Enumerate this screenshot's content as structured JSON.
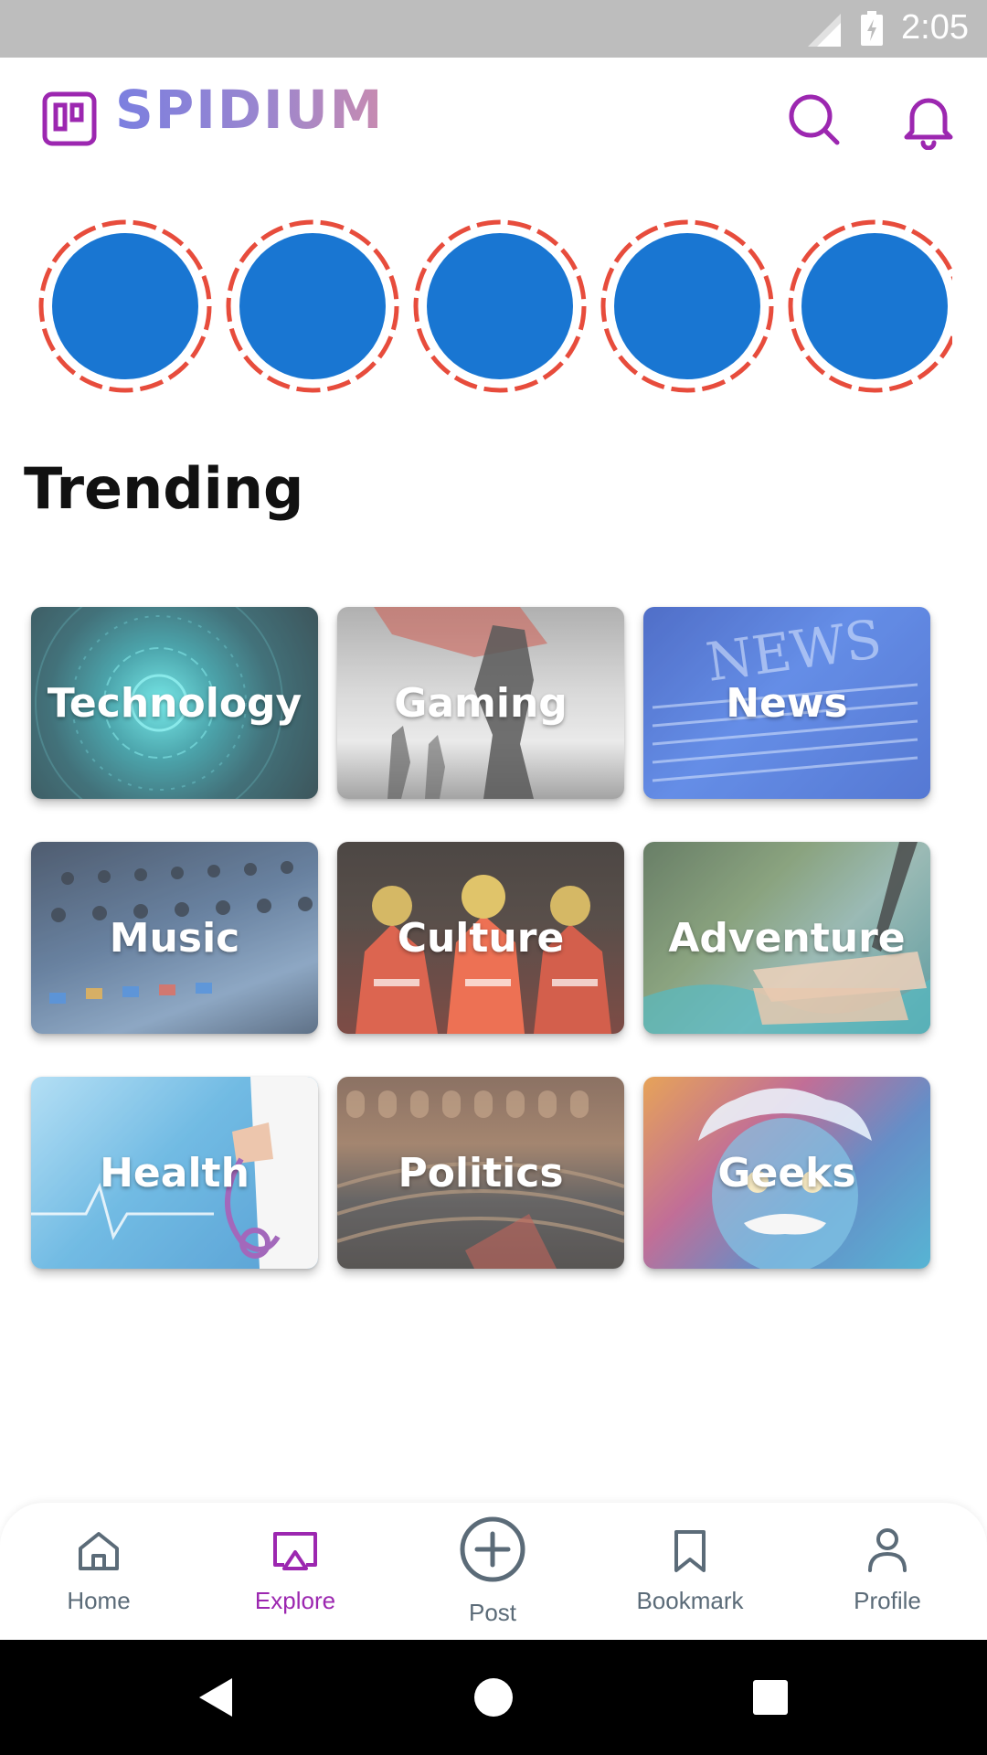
{
  "status_bar": {
    "time": "2:05",
    "signal_icon": "cell-signal-icon",
    "battery_icon": "battery-charging-icon"
  },
  "header": {
    "app_name": "SPIDIUM",
    "logo_icon": "board-icon",
    "search_icon": "search-icon",
    "notification_icon": "bell-icon"
  },
  "stories": {
    "count": 5,
    "ring_color": "#e74c3c",
    "avatar_color": "#1976d2"
  },
  "trending": {
    "title": "Trending",
    "categories": [
      {
        "label": "Technology"
      },
      {
        "label": "Gaming"
      },
      {
        "label": "News"
      },
      {
        "label": "Music"
      },
      {
        "label": "Culture"
      },
      {
        "label": "Adventure"
      },
      {
        "label": "Health"
      },
      {
        "label": "Politics"
      },
      {
        "label": "Geeks"
      }
    ]
  },
  "bottom_nav": {
    "items": [
      {
        "label": "Home",
        "icon": "home-icon",
        "active": false
      },
      {
        "label": "Explore",
        "icon": "explore-icon",
        "active": true
      },
      {
        "label": "Post",
        "icon": "add-circle-icon",
        "active": false
      },
      {
        "label": "Bookmark",
        "icon": "bookmark-icon",
        "active": false
      },
      {
        "label": "Profile",
        "icon": "profile-icon",
        "active": false
      }
    ],
    "active_color": "#9c27b0",
    "inactive_color": "#5b6b78"
  },
  "system_nav": {
    "back_icon": "back-icon",
    "home_icon": "system-home-icon",
    "recents_icon": "recents-icon"
  }
}
